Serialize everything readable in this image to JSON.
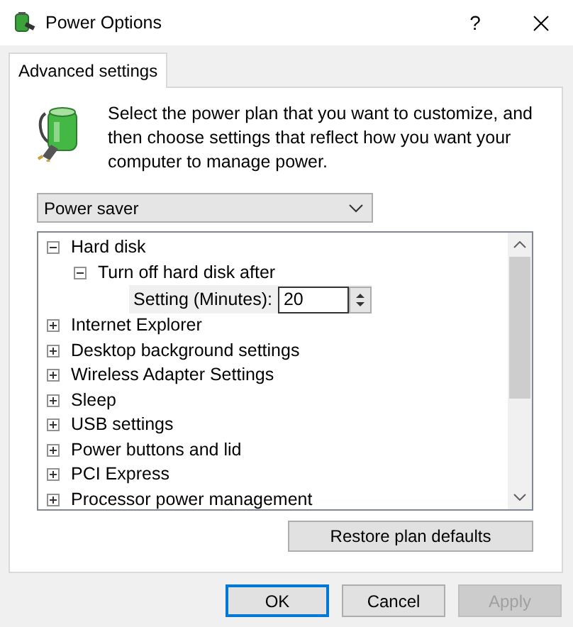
{
  "window": {
    "title": "Power Options",
    "help_button": "?"
  },
  "tabs": [
    {
      "label": "Advanced settings",
      "selected": true
    }
  ],
  "description": "Select the power plan that you want to customize, and then choose settings that reflect how you want your computer to manage power.",
  "plan_dropdown": {
    "value": "Power saver"
  },
  "tree": [
    {
      "label": "Hard disk",
      "expanded": true,
      "children": [
        {
          "label": "Turn off hard disk after",
          "expanded": true,
          "children": [
            {
              "kind": "setting",
              "label": "Setting (Minutes):",
              "value": "20"
            }
          ]
        }
      ]
    },
    {
      "label": "Internet Explorer",
      "expanded": false
    },
    {
      "label": "Desktop background settings",
      "expanded": false
    },
    {
      "label": "Wireless Adapter Settings",
      "expanded": false
    },
    {
      "label": "Sleep",
      "expanded": false
    },
    {
      "label": "USB settings",
      "expanded": false
    },
    {
      "label": "Power buttons and lid",
      "expanded": false
    },
    {
      "label": "PCI Express",
      "expanded": false
    },
    {
      "label": "Processor power management",
      "expanded": false
    }
  ],
  "restore_button": "Restore plan defaults",
  "buttons": [
    {
      "label": "OK",
      "default": true,
      "disabled": false
    },
    {
      "label": "Cancel",
      "default": false,
      "disabled": false
    },
    {
      "label": "Apply",
      "default": false,
      "disabled": true
    }
  ]
}
